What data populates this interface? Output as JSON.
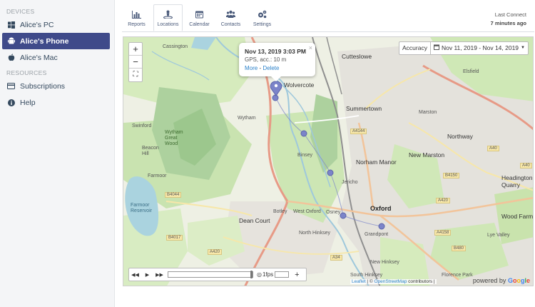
{
  "sidebar": {
    "devices_label": "DEVICES",
    "resources_label": "RESOURCES",
    "devices": [
      {
        "label": "Alice's PC",
        "icon": "windows-icon"
      },
      {
        "label": "Alice's Phone",
        "icon": "android-icon",
        "active": true
      },
      {
        "label": "Alice's Mac",
        "icon": "apple-icon"
      }
    ],
    "resources": [
      {
        "label": "Subscriptions",
        "icon": "card-icon"
      },
      {
        "label": "Help",
        "icon": "info-icon"
      }
    ]
  },
  "toolbar": {
    "tabs": [
      {
        "label": "Reports",
        "icon": "bar-chart-icon"
      },
      {
        "label": "Locations",
        "icon": "location-pin-icon",
        "active": true
      },
      {
        "label": "Calendar",
        "icon": "calendar-icon"
      },
      {
        "label": "Contacts",
        "icon": "contacts-icon"
      },
      {
        "label": "Settings",
        "icon": "gears-icon"
      }
    ],
    "last_connect_label": "Last Connect",
    "last_connect_value": "7 minutes ago"
  },
  "map": {
    "zoom_in": "+",
    "zoom_out": "−",
    "fullscreen": "⛶",
    "popup": {
      "title": "Nov 13, 2019 3:03 PM",
      "subtitle": "GPS, acc.: 10 m",
      "more": "More",
      "separator": " - ",
      "delete": "Delete",
      "close": "×"
    },
    "accuracy_label": "Accuracy",
    "date_range": "Nov 11, 2019 - Nov 14, 2019",
    "player": {
      "rewind": "◀◀",
      "play": "▶",
      "forward": "▶▶",
      "fps": "1fps",
      "plus": "+"
    },
    "attribution": {
      "leaflet": "Leaflet",
      "sep": " | © ",
      "osm": "OpenStreetMap",
      "rest": " contributors | "
    },
    "powered_by": "powered by",
    "google": [
      "G",
      "o",
      "o",
      "g",
      "l",
      "e"
    ],
    "places": [
      {
        "name": "Cassington",
        "cls": ""
      },
      {
        "name": "Cutteslowe",
        "cls": "big"
      },
      {
        "name": "Elsfield",
        "cls": ""
      },
      {
        "name": "Wolvercote",
        "cls": "big"
      },
      {
        "name": "Summertown",
        "cls": "big"
      },
      {
        "name": "Marston",
        "cls": ""
      },
      {
        "name": "Wytham",
        "cls": ""
      },
      {
        "name": "Swinford",
        "cls": ""
      },
      {
        "name": "Wytham Great Wood",
        "cls": ""
      },
      {
        "name": "Beacon Hill",
        "cls": ""
      },
      {
        "name": "Northway",
        "cls": "big"
      },
      {
        "name": "New Marston",
        "cls": "big"
      },
      {
        "name": "Binsey",
        "cls": ""
      },
      {
        "name": "Norham Manor",
        "cls": "big"
      },
      {
        "name": "Farmoor",
        "cls": ""
      },
      {
        "name": "Jericho",
        "cls": ""
      },
      {
        "name": "Headington Quarry",
        "cls": "big"
      },
      {
        "name": "Botley",
        "cls": ""
      },
      {
        "name": "West Oxford",
        "cls": ""
      },
      {
        "name": "Osney",
        "cls": ""
      },
      {
        "name": "Oxford",
        "cls": "city"
      },
      {
        "name": "Wood Farm",
        "cls": "big"
      },
      {
        "name": "Dean Court",
        "cls": "big"
      },
      {
        "name": "North Hinksey",
        "cls": ""
      },
      {
        "name": "Grandpont",
        "cls": ""
      },
      {
        "name": "Lye Valley",
        "cls": ""
      },
      {
        "name": "New Hinksey",
        "cls": ""
      },
      {
        "name": "South Hinksey",
        "cls": ""
      },
      {
        "name": "Florence Park",
        "cls": ""
      },
      {
        "name": "Farmoor Reservoir",
        "cls": ""
      }
    ],
    "roads": [
      "A40",
      "A4144",
      "B4150",
      "A420",
      "B4044",
      "B4017",
      "A420",
      "A34",
      "A4158",
      "B480",
      "A40"
    ]
  },
  "colors": {
    "active_nav": "#3f4a8a",
    "link": "#2a80c9",
    "water": "#aad3df",
    "woods": "#add19e",
    "marker": "#7b84c9"
  }
}
